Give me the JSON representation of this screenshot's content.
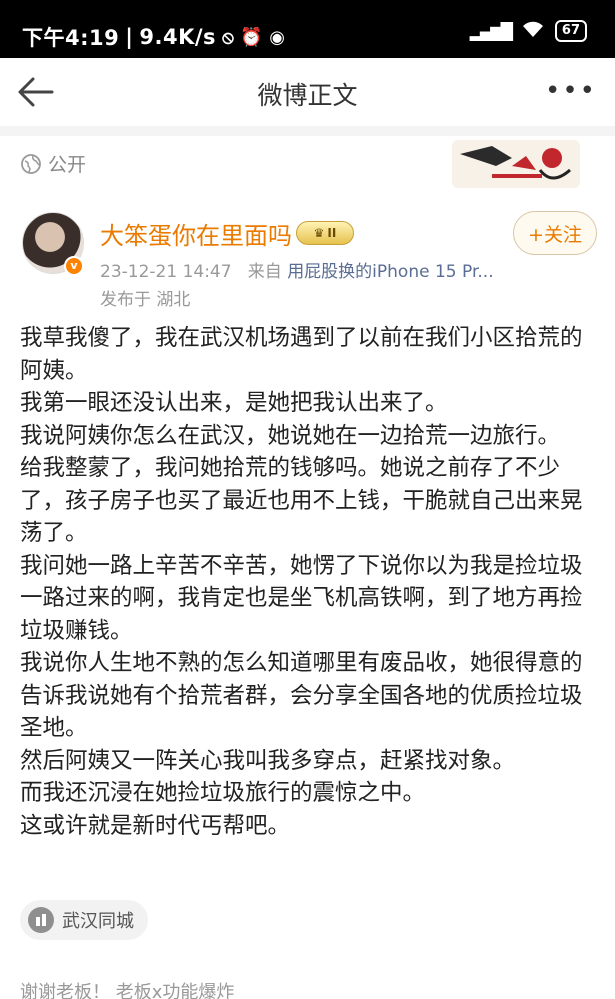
{
  "status_bar": {
    "time": "下午4:19",
    "speed": "9.4K/s",
    "battery": "67"
  },
  "header": {
    "title": "微博正文"
  },
  "post": {
    "visibility": "公开",
    "username": "大笨蛋你在里面吗",
    "user_badge": "II",
    "timestamp": "23-12-21 14:47",
    "source_prefix": "来自",
    "source_device": "用屁股换的iPhone 15 Pr...",
    "location": "发布于 湖北",
    "follow_label": "+关注",
    "paragraphs": [
      "我草我傻了，我在武汉机场遇到了以前在我们小区拾荒的阿姨。",
      "我第一眼还没认出来，是她把我认出来了。",
      "我说阿姨你怎么在武汉，她说她在一边拾荒一边旅行。",
      "给我整蒙了，我问她拾荒的钱够吗。她说之前存了不少了，孩子房子也买了最近也用不上钱，干脆就自己出来晃荡了。",
      "我问她一路上辛苦不辛苦，她愣了下说你以为我是捡垃圾一路过来的啊，我肯定也是坐飞机高铁啊，到了地方再捡垃圾赚钱。",
      "我说你人生地不熟的怎么知道哪里有废品收，她很得意的告诉我说她有个拾荒者群，会分享全国各地的优质捡垃圾圣地。",
      "然后阿姨又一阵关心我叫我多穿点，赶紧找对象。",
      "而我还沉浸在她捡垃圾旅行的震惊之中。",
      "这或许就是新时代丐帮吧。"
    ],
    "topic": "武汉同城"
  },
  "footer": {
    "text": "谢谢老板！ 老板x功能爆炸"
  },
  "colors": {
    "accent_orange": "#ea7b00",
    "link_blue": "#5a6d93"
  }
}
